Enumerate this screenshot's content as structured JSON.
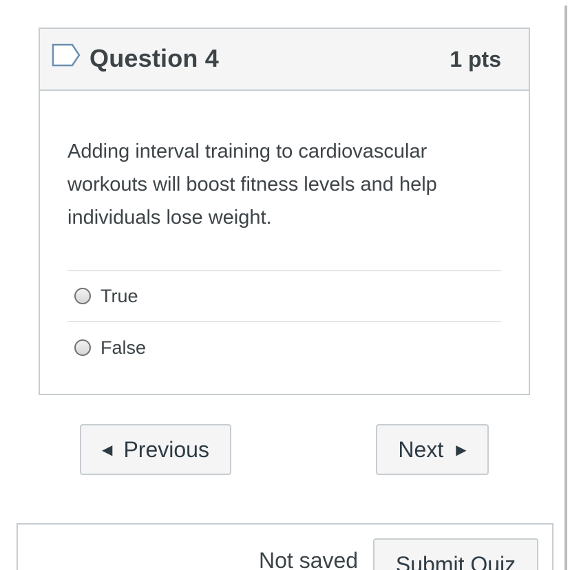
{
  "question": {
    "title": "Question 4",
    "points": "1 pts",
    "text": "Adding interval training to cardiovascular workouts will boost fitness levels and help individuals lose weight.",
    "answers": [
      {
        "label": "True",
        "selected": false
      },
      {
        "label": "False",
        "selected": false
      }
    ]
  },
  "navigation": {
    "previous_label": "Previous",
    "next_label": "Next"
  },
  "footer": {
    "save_status": "Not saved",
    "submit_label": "Submit Quiz"
  },
  "icons": {
    "flag": "flag-outline-icon",
    "previous": "caret-left-icon",
    "next": "caret-right-icon"
  },
  "colors": {
    "border": "#c7cdd1",
    "header_bg": "#f5f5f5",
    "text": "#3d4448",
    "flag_stroke": "#6b8fb0"
  }
}
